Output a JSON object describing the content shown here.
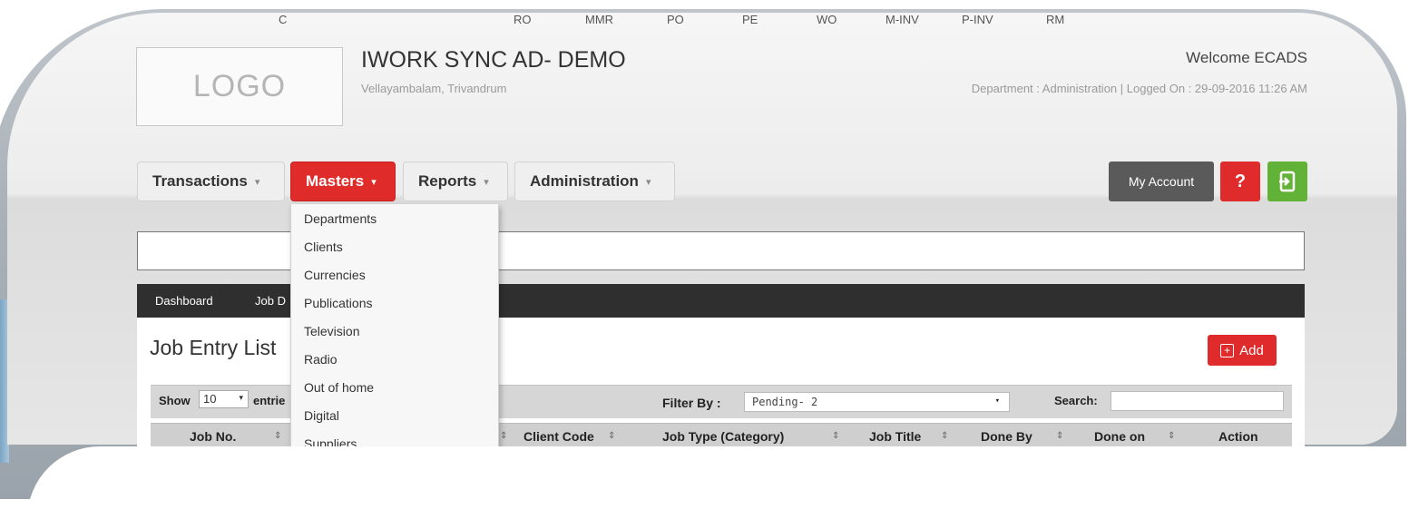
{
  "header": {
    "logo_text": "LOGO",
    "app_title": "IWORK SYNC AD- DEMO",
    "location": "Vellayambalam, Trivandrum",
    "welcome": "Welcome ECADS",
    "dept_info": "Department : Administration | Logged On : 29-09-2016 11:26 AM"
  },
  "nav": {
    "transactions": "Transactions",
    "masters": "Masters",
    "reports": "Reports",
    "administration": "Administration",
    "caret": "▾",
    "my_account": "My Account",
    "help": "?"
  },
  "masters_menu": [
    "Departments",
    "Clients",
    "Currencies",
    "Publications",
    "Television",
    "Radio",
    "Out of home",
    "Digital",
    "Suppliers"
  ],
  "shortcuts": [
    "C",
    "RO",
    "MMR",
    "PO",
    "PE",
    "WO",
    "M-INV",
    "P-INV",
    "RM"
  ],
  "breadcrumb": {
    "dashboard": "Dashboard",
    "job": "Job D"
  },
  "list": {
    "title": "Job Entry List",
    "add_label": "Add",
    "show_label": "Show",
    "show_value": "10",
    "entries_label": "entrie",
    "filter_label": "Filter By :",
    "filter_value": "Pending- 2",
    "search_label": "Search:",
    "columns": [
      "Job No.",
      "Client Code",
      "Job Type (Category)",
      "Job Title",
      "Done By",
      "Done on",
      "Action"
    ]
  },
  "colors": {
    "accent_red": "#e02b2b",
    "green": "#62b238",
    "dark": "#2f2f2f"
  }
}
